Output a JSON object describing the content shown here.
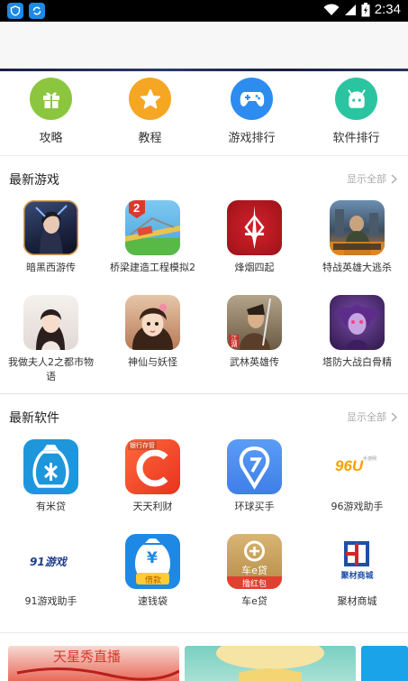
{
  "status_bar": {
    "time": "2:34"
  },
  "quick_nav": [
    {
      "label": "攻略",
      "icon": "gift-icon",
      "color": "#8cc63f"
    },
    {
      "label": "教程",
      "icon": "star-icon",
      "color": "#f5a623"
    },
    {
      "label": "游戏排行",
      "icon": "gamepad-icon",
      "color": "#2d8cf0"
    },
    {
      "label": "软件排行",
      "icon": "android-icon",
      "color": "#2bc4a0"
    }
  ],
  "latest_games": {
    "title": "最新游戏",
    "more": "显示全部",
    "items": [
      {
        "name": "暗黑西游传"
      },
      {
        "name": "桥梁建造工程模拟2"
      },
      {
        "name": "烽烟四起"
      },
      {
        "name": "特战英雄大逃杀"
      },
      {
        "name": "我做夫人2之都市物语"
      },
      {
        "name": "神仙与妖怪"
      },
      {
        "name": "武林英雄传"
      },
      {
        "name": "塔防大战白骨精"
      }
    ]
  },
  "latest_software": {
    "title": "最新软件",
    "more": "显示全部",
    "items": [
      {
        "name": "有米贷"
      },
      {
        "name": "天天利财"
      },
      {
        "name": "环球买手"
      },
      {
        "name": "96游戏助手"
      },
      {
        "name": "91游戏助手"
      },
      {
        "name": "速钱袋"
      },
      {
        "name": "车e贷"
      },
      {
        "name": "聚材商城"
      }
    ]
  },
  "icon_text": {
    "bridge_badge": "2",
    "tiantian_tag": "银行存管",
    "icon_96": "96U",
    "icon_96_small": "手游网",
    "icon_91": "91游戏",
    "suqian_yen": "¥",
    "suqian_sub": "借款",
    "chee_title": "车e贷",
    "chee_sub": "撸红包",
    "jucai": "聚材商城",
    "wulin_tag": "江湖"
  },
  "bottom_banner": {
    "text": "天星秀直播"
  }
}
